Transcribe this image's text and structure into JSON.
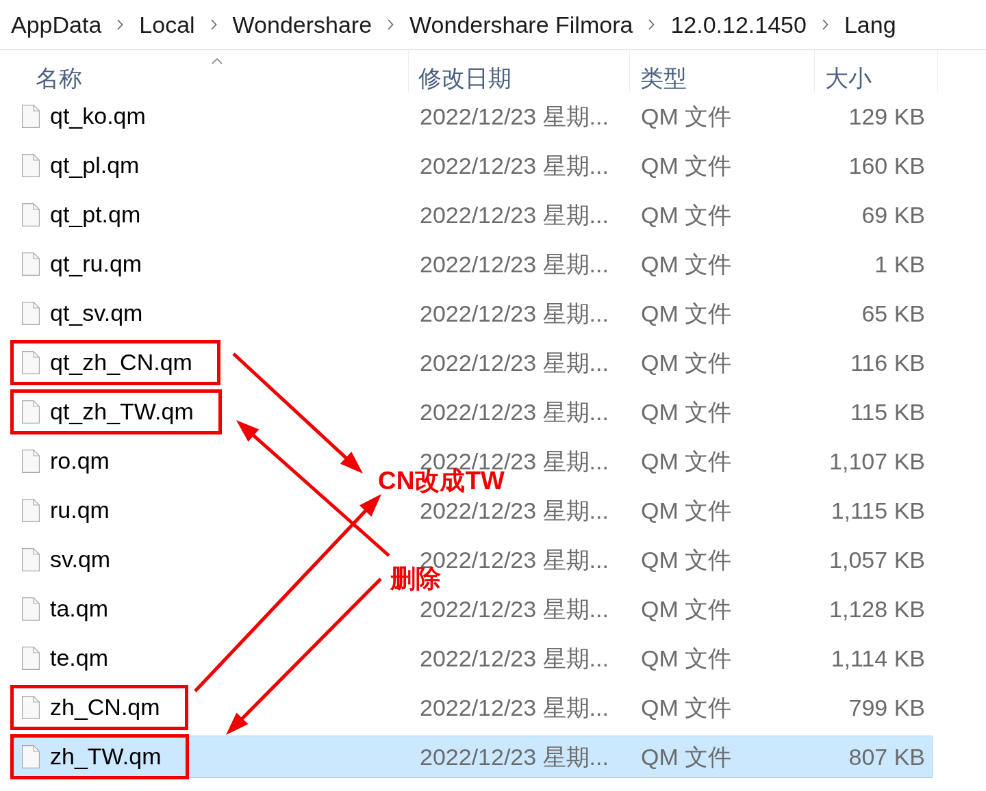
{
  "breadcrumb": [
    "AppData",
    "Local",
    "Wondershare",
    "Wondershare Filmora",
    "12.0.12.1450",
    "Lang"
  ],
  "columns": [
    {
      "label": "名称",
      "sorted": true
    },
    {
      "label": "修改日期",
      "sorted": false
    },
    {
      "label": "类型",
      "sorted": false
    },
    {
      "label": "大小",
      "sorted": false
    }
  ],
  "rows": [
    {
      "name": "qt_ko.qm",
      "modified": "2022/12/23 星期...",
      "type": "QM 文件",
      "size": "129 KB",
      "selected": false,
      "framed": false
    },
    {
      "name": "qt_pl.qm",
      "modified": "2022/12/23 星期...",
      "type": "QM 文件",
      "size": "160 KB",
      "selected": false,
      "framed": false
    },
    {
      "name": "qt_pt.qm",
      "modified": "2022/12/23 星期...",
      "type": "QM 文件",
      "size": "69 KB",
      "selected": false,
      "framed": false
    },
    {
      "name": "qt_ru.qm",
      "modified": "2022/12/23 星期...",
      "type": "QM 文件",
      "size": "1 KB",
      "selected": false,
      "framed": false
    },
    {
      "name": "qt_sv.qm",
      "modified": "2022/12/23 星期...",
      "type": "QM 文件",
      "size": "65 KB",
      "selected": false,
      "framed": false
    },
    {
      "name": "qt_zh_CN.qm",
      "modified": "2022/12/23 星期...",
      "type": "QM 文件",
      "size": "116 KB",
      "selected": false,
      "framed": true
    },
    {
      "name": "qt_zh_TW.qm",
      "modified": "2022/12/23 星期...",
      "type": "QM 文件",
      "size": "115 KB",
      "selected": false,
      "framed": true
    },
    {
      "name": "ro.qm",
      "modified": "2022/12/23 星期...",
      "type": "QM 文件",
      "size": "1,107 KB",
      "selected": false,
      "framed": false
    },
    {
      "name": "ru.qm",
      "modified": "2022/12/23 星期...",
      "type": "QM 文件",
      "size": "1,115 KB",
      "selected": false,
      "framed": false
    },
    {
      "name": "sv.qm",
      "modified": "2022/12/23 星期...",
      "type": "QM 文件",
      "size": "1,057 KB",
      "selected": false,
      "framed": false
    },
    {
      "name": "ta.qm",
      "modified": "2022/12/23 星期...",
      "type": "QM 文件",
      "size": "1,128 KB",
      "selected": false,
      "framed": false
    },
    {
      "name": "te.qm",
      "modified": "2022/12/23 星期...",
      "type": "QM 文件",
      "size": "1,114 KB",
      "selected": false,
      "framed": false
    },
    {
      "name": "zh_CN.qm",
      "modified": "2022/12/23 星期...",
      "type": "QM 文件",
      "size": "799 KB",
      "selected": false,
      "framed": true
    },
    {
      "name": "zh_TW.qm",
      "modified": "2022/12/23 星期...",
      "type": "QM 文件",
      "size": "807 KB",
      "selected": true,
      "framed": true
    }
  ],
  "annotations": [
    {
      "text": "CN改成TW"
    },
    {
      "text": "删除"
    }
  ]
}
